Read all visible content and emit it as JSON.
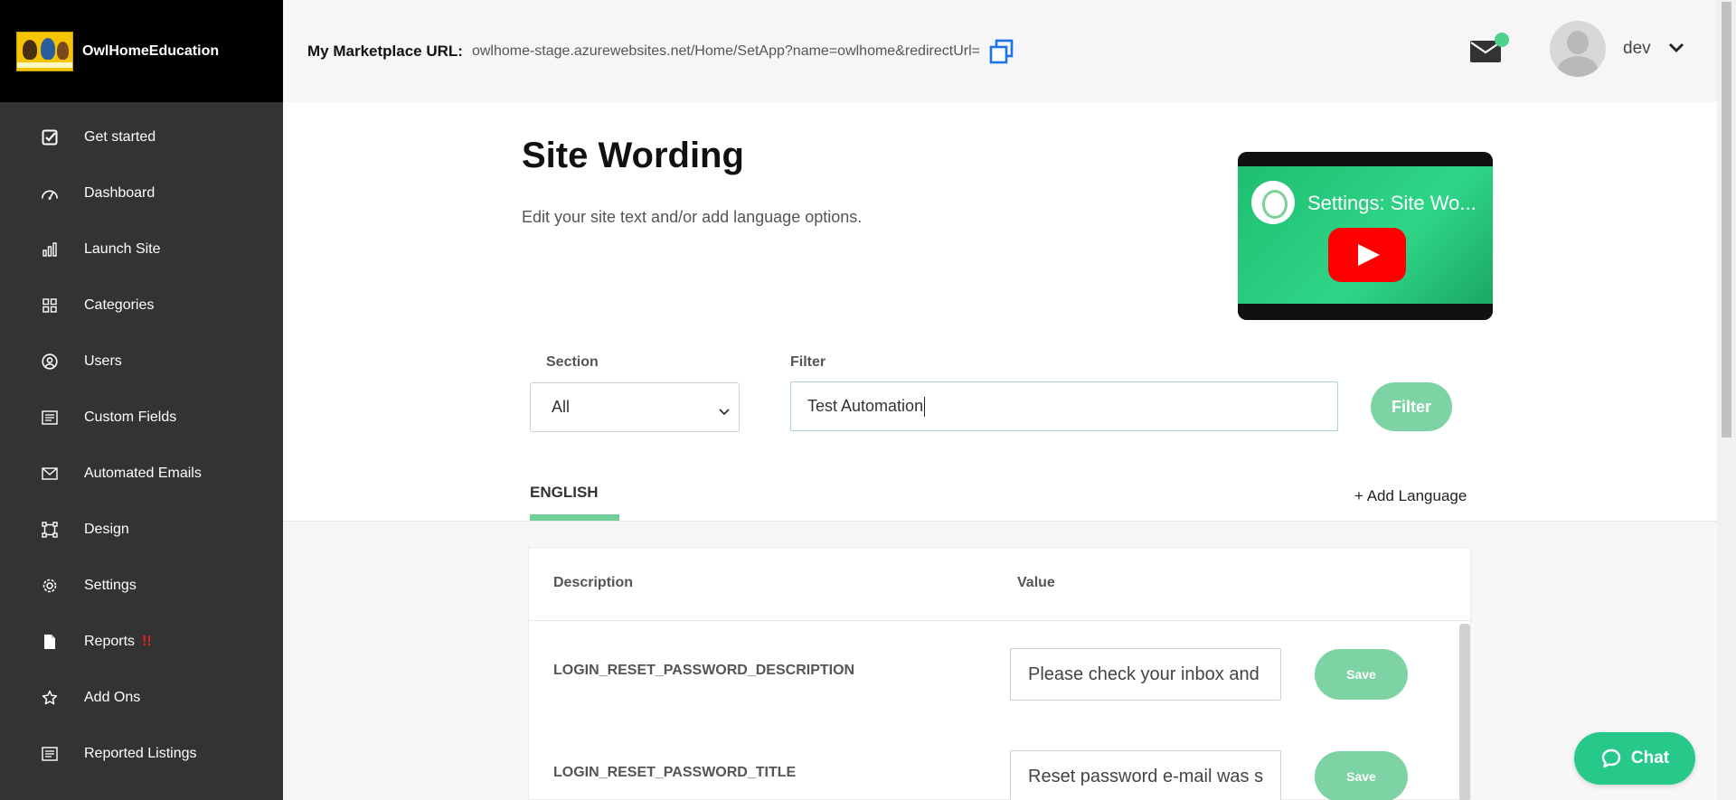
{
  "brand": {
    "name": "OwlHomeEducation"
  },
  "sidebar": {
    "items": [
      {
        "label": "Get started",
        "icon": "checkbox-icon"
      },
      {
        "label": "Dashboard",
        "icon": "gauge-icon"
      },
      {
        "label": "Launch Site",
        "icon": "bar-chart-icon"
      },
      {
        "label": "Categories",
        "icon": "grid-icon"
      },
      {
        "label": "Users",
        "icon": "user-circle-icon"
      },
      {
        "label": "Custom Fields",
        "icon": "list-icon"
      },
      {
        "label": "Automated Emails",
        "icon": "envelope-icon"
      },
      {
        "label": "Design",
        "icon": "frame-icon"
      },
      {
        "label": "Settings",
        "icon": "gear-icon"
      },
      {
        "label": "Reports",
        "icon": "file-icon",
        "badge": "!!"
      },
      {
        "label": "Add Ons",
        "icon": "star-icon"
      },
      {
        "label": "Reported Listings",
        "icon": "list-icon"
      }
    ]
  },
  "header": {
    "marketplace_label": "My Marketplace URL:",
    "marketplace_url": "owlhome-stage.azurewebsites.net/Home/SetApp?name=owlhome&redirectUrl=",
    "user_name": "dev"
  },
  "page": {
    "title": "Site Wording",
    "subtitle": "Edit your site text and/or add language options.",
    "video_title": "Settings: Site Wo..."
  },
  "filters": {
    "section_label": "Section",
    "section_value": "All",
    "filter_label": "Filter",
    "filter_value": "Test Automation",
    "filter_button": "Filter"
  },
  "tabs": {
    "active": "ENGLISH",
    "add_language": "+ Add Language"
  },
  "table": {
    "headers": {
      "description": "Description",
      "value": "Value"
    },
    "rows": [
      {
        "key": "LOGIN_RESET_PASSWORD_DESCRIPTION",
        "value": "Please check your inbox and",
        "save": "Save"
      },
      {
        "key": "LOGIN_RESET_PASSWORD_TITLE",
        "value": "Reset password e-mail was s",
        "save": "Save"
      }
    ]
  },
  "chat": {
    "label": "Chat"
  },
  "colors": {
    "sidebar_bg": "#333333",
    "accent_green": "#7dd3a3",
    "chat_green": "#27c98a",
    "notification_dot": "#4fd18b",
    "copy_icon_blue": "#1a73e8",
    "badge_red": "#e02020"
  }
}
